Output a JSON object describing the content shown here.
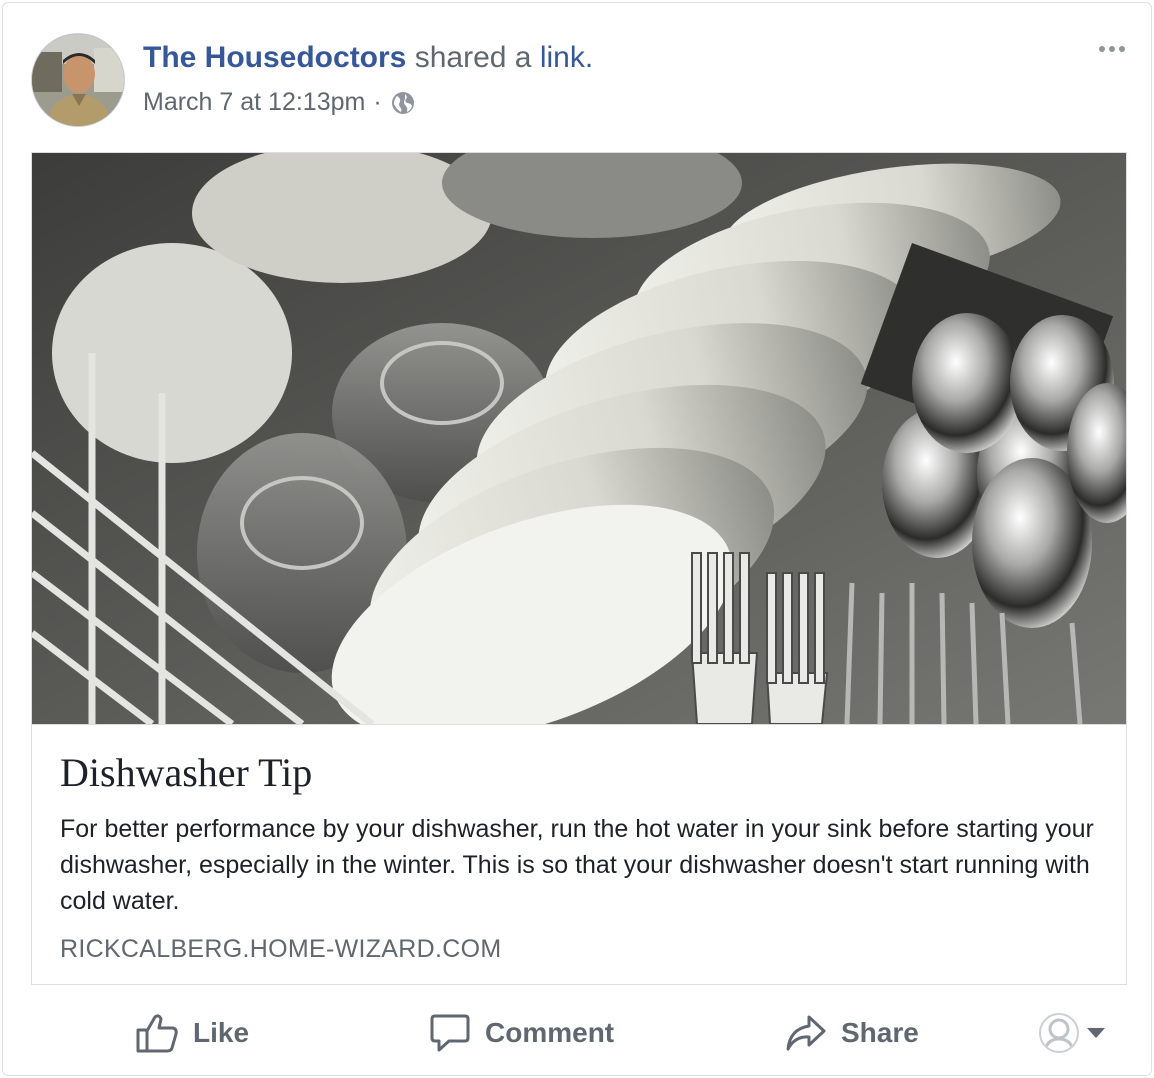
{
  "post": {
    "author": "The Housedoctors",
    "action_text": "shared a",
    "action_link": "link.",
    "timestamp": "March 7 at 12:13pm",
    "separator": "·",
    "privacy_icon": "globe-icon",
    "more_icon": "ellipsis-icon"
  },
  "link": {
    "image_alt": "Dishes and silverware in a dishwasher rack",
    "title": "Dishwasher Tip",
    "description": "For better performance by your dishwasher, run the hot water in your sink before starting your dishwasher, especially in the winter. This is so that your dishwasher doesn't start running with cold water.",
    "domain": "RICKCALBERG.HOME-WIZARD.COM"
  },
  "actions": {
    "like": "Like",
    "comment": "Comment",
    "share": "Share"
  },
  "colors": {
    "link_blue": "#365899",
    "muted": "#616770",
    "border": "#dddfe2"
  }
}
